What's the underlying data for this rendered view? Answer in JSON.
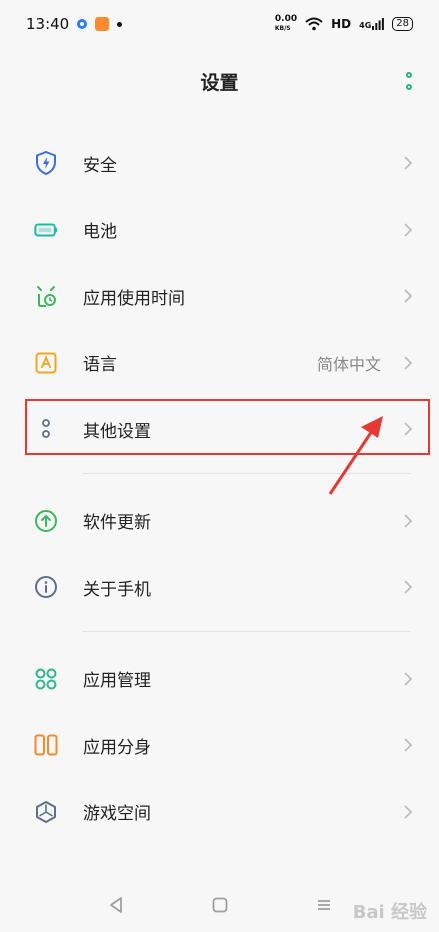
{
  "status_bar": {
    "time": "13:40",
    "speed_value": "0.00",
    "speed_unit": "KB/S",
    "network": "HD",
    "signal": "4G",
    "battery": "28"
  },
  "header": {
    "title": "设置"
  },
  "items": [
    {
      "label": "安全",
      "icon": "shield-icon"
    },
    {
      "label": "电池",
      "icon": "battery-icon"
    },
    {
      "label": "应用使用时间",
      "icon": "alarm-clock-icon"
    },
    {
      "label": "语言",
      "value": "简体中文",
      "icon": "language-a-icon"
    },
    {
      "label": "其他设置",
      "icon": "more-settings-icon"
    },
    {
      "label": "软件更新",
      "icon": "update-arrow-icon"
    },
    {
      "label": "关于手机",
      "icon": "info-icon"
    },
    {
      "label": "应用管理",
      "icon": "app-grid-icon"
    },
    {
      "label": "应用分身",
      "icon": "dual-app-icon"
    },
    {
      "label": "游戏空间",
      "icon": "game-space-icon"
    }
  ],
  "colors": {
    "accent": "#2db27f",
    "highlight": "#e53935",
    "shield": "#3b6fd9",
    "battery": "#21b9a6",
    "clock": "#41b45e",
    "language": "#f2a623",
    "app_manage": "#2fb68c",
    "dual_app": "#f28a2e"
  },
  "watermark": "Bai 经验"
}
